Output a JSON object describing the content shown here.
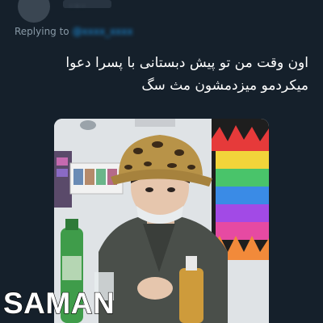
{
  "header": {
    "display_name": "",
    "handle": "· ·· ·"
  },
  "reply": {
    "prefix": "Replying to",
    "target": "@xxxx_xxxx"
  },
  "tweet": {
    "line1": "اون وقت من تو پیش دبستانی با پسرا دعوا",
    "line2": "میکردمو میزدمشون مث سگ"
  },
  "media": {
    "description_icon": "photo",
    "colors": {
      "hat": "#b89348",
      "jacket": "#4a4f4a",
      "bottle_green": "#3f9c4a",
      "bottle_amber": "#d9a23a"
    }
  },
  "watermark": "SAMAN"
}
